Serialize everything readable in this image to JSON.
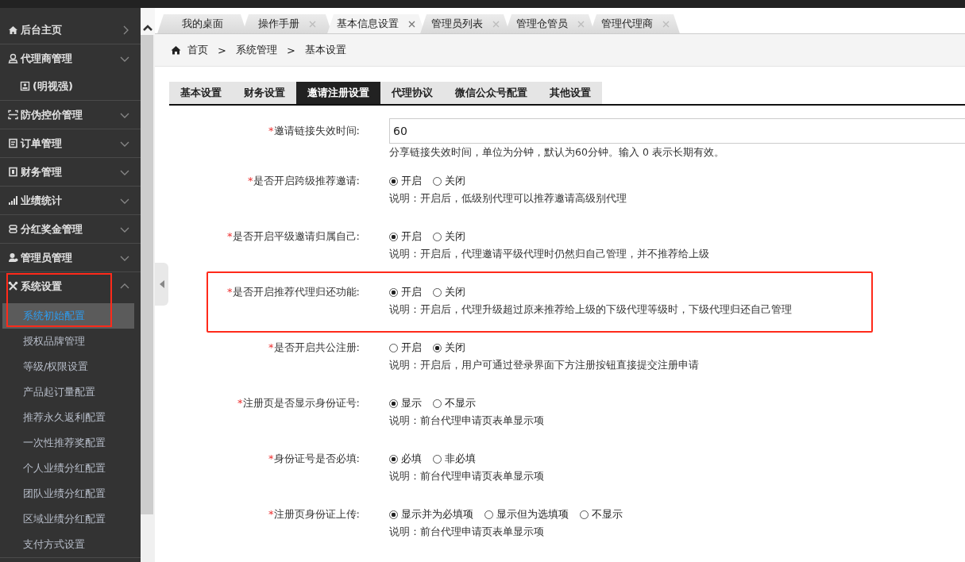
{
  "sidebar": {
    "items": [
      {
        "kind": "link",
        "label": "后台主页"
      },
      {
        "kind": "group",
        "label": "代理商管理",
        "expanded": false
      },
      {
        "kind": "account",
        "label": "(明视强)"
      },
      {
        "kind": "group",
        "label": "防伪控价管理",
        "expanded": false
      },
      {
        "kind": "group",
        "label": "订单管理",
        "expanded": false
      },
      {
        "kind": "group",
        "label": "财务管理",
        "expanded": false
      },
      {
        "kind": "group",
        "label": "业绩统计",
        "expanded": false
      },
      {
        "kind": "group",
        "label": "分红奖金管理",
        "expanded": false
      },
      {
        "kind": "group",
        "label": "管理员管理",
        "expanded": false
      },
      {
        "kind": "group",
        "label": "系统设置",
        "expanded": true,
        "highlighted": true,
        "children": [
          {
            "label": "系统初始配置",
            "selected": true
          },
          {
            "label": "授权品牌管理",
            "selected": false
          },
          {
            "label": "等级/权限设置",
            "selected": false
          },
          {
            "label": "产品起订量配置",
            "selected": false
          },
          {
            "label": "推荐永久返利配置",
            "selected": false
          },
          {
            "label": "一次性推荐奖配置",
            "selected": false
          },
          {
            "label": "个人业绩分红配置",
            "selected": false
          },
          {
            "label": "团队业绩分红配置",
            "selected": false
          },
          {
            "label": "区域业绩分红配置",
            "selected": false
          },
          {
            "label": "支付方式设置",
            "selected": false
          }
        ]
      }
    ]
  },
  "page_tabs": [
    {
      "label": "我的桌面",
      "selected": false,
      "closable": false
    },
    {
      "label": "操作手册",
      "selected": false,
      "closable": true
    },
    {
      "label": "基本信息设置",
      "selected": true,
      "closable": true
    },
    {
      "label": "管理员列表",
      "selected": false,
      "closable": true
    },
    {
      "label": "管理仓管员",
      "selected": false,
      "closable": true
    },
    {
      "label": "管理代理商",
      "selected": false,
      "closable": true
    }
  ],
  "breadcrumb": [
    {
      "kind": "crumb",
      "text": "首页"
    },
    {
      "kind": "sep",
      "text": ">"
    },
    {
      "kind": "crumb",
      "text": "系统管理"
    },
    {
      "kind": "sep",
      "text": ">"
    },
    {
      "kind": "crumb",
      "text": "基本设置"
    }
  ],
  "settings_tabs": [
    {
      "label": "基本设置",
      "selected": false
    },
    {
      "label": "财务设置",
      "selected": false
    },
    {
      "label": "邀请注册设置",
      "selected": true
    },
    {
      "label": "代理协议",
      "selected": false
    },
    {
      "label": "微信公众号配置",
      "selected": false
    },
    {
      "label": "其他设置",
      "selected": false
    }
  ],
  "form": [
    {
      "kind": "text",
      "required_mark": "*",
      "label": "邀请链接失效时间:",
      "value": "60",
      "hint": "分享链接失效时间，单位为分钟，默认为60分钟。输入 0 表示长期有效。"
    },
    {
      "kind": "radio",
      "required_mark": "*",
      "label": "是否开启跨级推荐邀请:",
      "options": [
        {
          "label": "开启",
          "selected": true
        },
        {
          "label": "关闭",
          "selected": false
        }
      ],
      "hint": "说明：开启后，低级别代理可以推荐邀请高级别代理"
    },
    {
      "kind": "radio",
      "required_mark": "*",
      "label": "是否开启平级邀请归属自己:",
      "options": [
        {
          "label": "开启",
          "selected": true
        },
        {
          "label": "关闭",
          "selected": false
        }
      ],
      "hint": "说明：开启后，代理邀请平级代理时仍然归自己管理，并不推荐给上级"
    },
    {
      "kind": "radio",
      "required_mark": "*",
      "highlighted": true,
      "label": "是否开启推荐代理归还功能:",
      "options": [
        {
          "label": "开启",
          "selected": true
        },
        {
          "label": "关闭",
          "selected": false
        }
      ],
      "hint": "说明：开启后，代理升级超过原来推荐给上级的下级代理等级时，下级代理归还自己管理"
    },
    {
      "kind": "radio",
      "required_mark": "*",
      "label": "是否开启共公注册:",
      "options": [
        {
          "label": "开启",
          "selected": false
        },
        {
          "label": "关闭",
          "selected": true
        }
      ],
      "hint": "说明：开启后，用户可通过登录界面下方注册按钮直接提交注册申请"
    },
    {
      "kind": "radio",
      "required_mark": "*",
      "label": "注册页是否显示身份证号:",
      "options": [
        {
          "label": "显示",
          "selected": true
        },
        {
          "label": "不显示",
          "selected": false
        }
      ],
      "hint": "说明：前台代理申请页表单显示项"
    },
    {
      "kind": "radio",
      "required_mark": "*",
      "label": "身份证号是否必填:",
      "options": [
        {
          "label": "必填",
          "selected": true
        },
        {
          "label": "非必填",
          "selected": false
        }
      ],
      "hint": "说明：前台代理申请页表单显示项"
    },
    {
      "kind": "radio",
      "required_mark": "*",
      "label": "注册页身份证上传:",
      "options": [
        {
          "label": "显示并为必填项",
          "selected": true
        },
        {
          "label": "显示但为选填项",
          "selected": false
        },
        {
          "label": "不显示",
          "selected": false
        }
      ],
      "hint": "说明：前台代理申请页表单显示项"
    }
  ]
}
